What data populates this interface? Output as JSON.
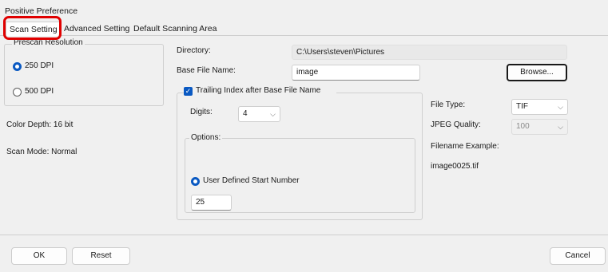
{
  "window": {
    "title": "Positive Preference"
  },
  "tabs": [
    {
      "label": "Scan Setting"
    },
    {
      "label": "Advanced Setting"
    },
    {
      "label": "Default Scanning Area"
    }
  ],
  "prescan": {
    "legend": "Prescan Resolution",
    "options": [
      {
        "label": "250 DPI",
        "selected": true
      },
      {
        "label": "500 DPI",
        "selected": false
      }
    ]
  },
  "info": {
    "color_depth": "Color Depth: 16 bit",
    "scan_mode": "Scan Mode: Normal"
  },
  "directory": {
    "label": "Directory:",
    "value": "C:\\Users\\steven\\Pictures"
  },
  "base_file": {
    "label": "Base File Name:",
    "value": "image"
  },
  "browse": {
    "label": "Browse..."
  },
  "trailing": {
    "label": "Trailing Index after Base File Name",
    "checked": true,
    "digits_label": "Digits:",
    "digits_value": "4",
    "options_legend": "Options:",
    "radio_label": "User Defined Start Number",
    "start_value": "25"
  },
  "file_type": {
    "label": "File Type:",
    "value": "TIF"
  },
  "jpeg_quality": {
    "label": "JPEG Quality:",
    "value": "100"
  },
  "filename_example": {
    "label": "Filename Example:",
    "value": "image0025.tif"
  },
  "buttons": {
    "ok": "OK",
    "reset": "Reset",
    "cancel": "Cancel"
  },
  "colors": {
    "accent": "#0a59c2",
    "highlight": "#e00000"
  }
}
